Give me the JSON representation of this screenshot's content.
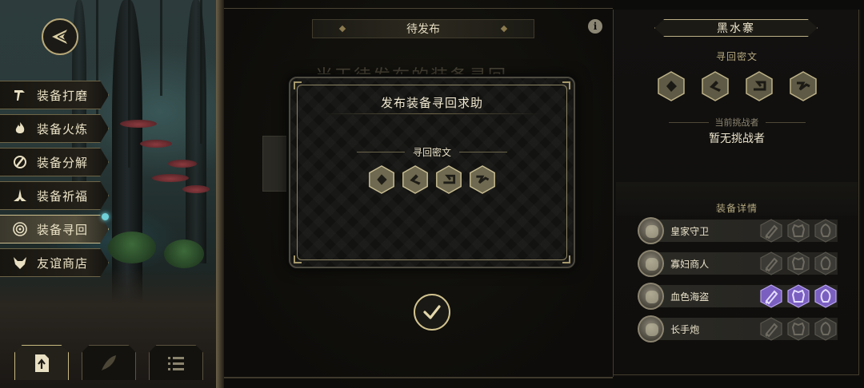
{
  "nav": {
    "back_icon": "back-arrow-icon",
    "menu": [
      {
        "label": "装备打磨",
        "icon": "hammer-icon",
        "active": false
      },
      {
        "label": "装备火炼",
        "icon": "flame-icon",
        "active": false
      },
      {
        "label": "装备分解",
        "icon": "disassemble-icon",
        "active": false
      },
      {
        "label": "装备祈福",
        "icon": "pray-icon",
        "active": false
      },
      {
        "label": "装备寻回",
        "icon": "target-icon",
        "active": true
      },
      {
        "label": "友谊商店",
        "icon": "fox-icon",
        "active": false
      }
    ],
    "bottom_tabs": [
      {
        "icon": "upload-icon",
        "active": true
      },
      {
        "icon": "feather-icon",
        "active": false
      },
      {
        "icon": "list-icon",
        "active": false
      }
    ]
  },
  "center": {
    "tab_label": "待发布",
    "info_icon": "i",
    "ghost_heading": "当天待发布的装备寻回",
    "dialog": {
      "title": "发布装备寻回求助",
      "cipher_label": "寻回密文",
      "glyphs": [
        "cipher-glyph-1",
        "cipher-glyph-2",
        "cipher-glyph-3",
        "cipher-glyph-4"
      ]
    },
    "confirm_icon": "checkmark-icon"
  },
  "right_panel": {
    "location": "黑水寨",
    "cipher_label": "寻回密文",
    "glyphs": [
      "cipher-glyph-1",
      "cipher-glyph-2",
      "cipher-glyph-3",
      "cipher-glyph-4"
    ],
    "challenger_label": "当前挑战者",
    "challenger_value": "暂无挑战者",
    "details_label": "装备详情",
    "heroes": [
      {
        "name": "皇家守卫",
        "slots_unlocked": [
          false,
          false,
          false
        ]
      },
      {
        "name": "寡妇商人",
        "slots_unlocked": [
          false,
          false,
          false
        ]
      },
      {
        "name": "血色海盗",
        "slots_unlocked": [
          true,
          true,
          true
        ]
      },
      {
        "name": "长手炮",
        "slots_unlocked": [
          false,
          false,
          false
        ]
      }
    ],
    "slot_names": [
      "weapon-slot-icon",
      "armor-slot-icon",
      "trinket-slot-icon"
    ]
  },
  "colors": {
    "accent_gold": "#c9b981",
    "active_glow": "#7fe6ef",
    "unlocked_slot": "#7a5fc0"
  }
}
